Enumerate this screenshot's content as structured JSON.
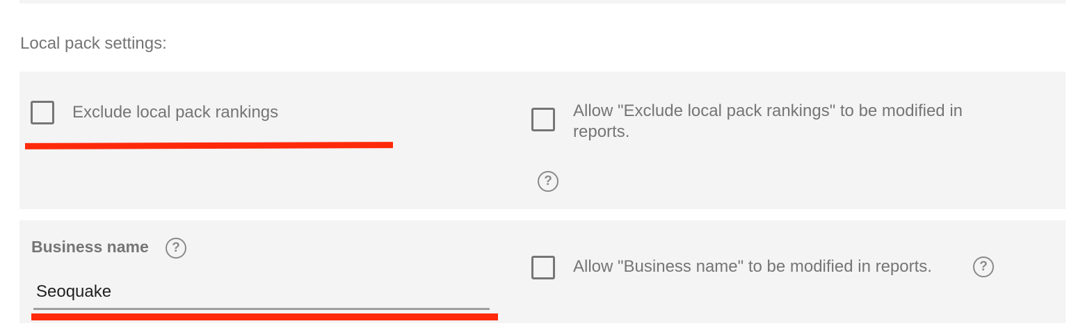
{
  "section_title": "Local pack settings:",
  "exclude_local_pack": {
    "label": "Exclude local pack rankings",
    "checked": false
  },
  "allow_exclude_modify": {
    "label_line1": "Allow \"Exclude local pack rankings\" to be modified in",
    "label_line2": "reports.",
    "checked": false,
    "help_icon": "help-circle-icon"
  },
  "business_name": {
    "label": "Business name",
    "value": "Seoquake",
    "help_icon": "help-circle-icon"
  },
  "allow_business_name_modify": {
    "label": "Allow \"Business name\" to be modified in reports.",
    "checked": false,
    "help_icon": "help-circle-icon"
  },
  "help_glyph": "?",
  "colors": {
    "panel_bg": "#f4f4f4",
    "text": "#757575",
    "annotation_red": "#ff2a0a"
  }
}
